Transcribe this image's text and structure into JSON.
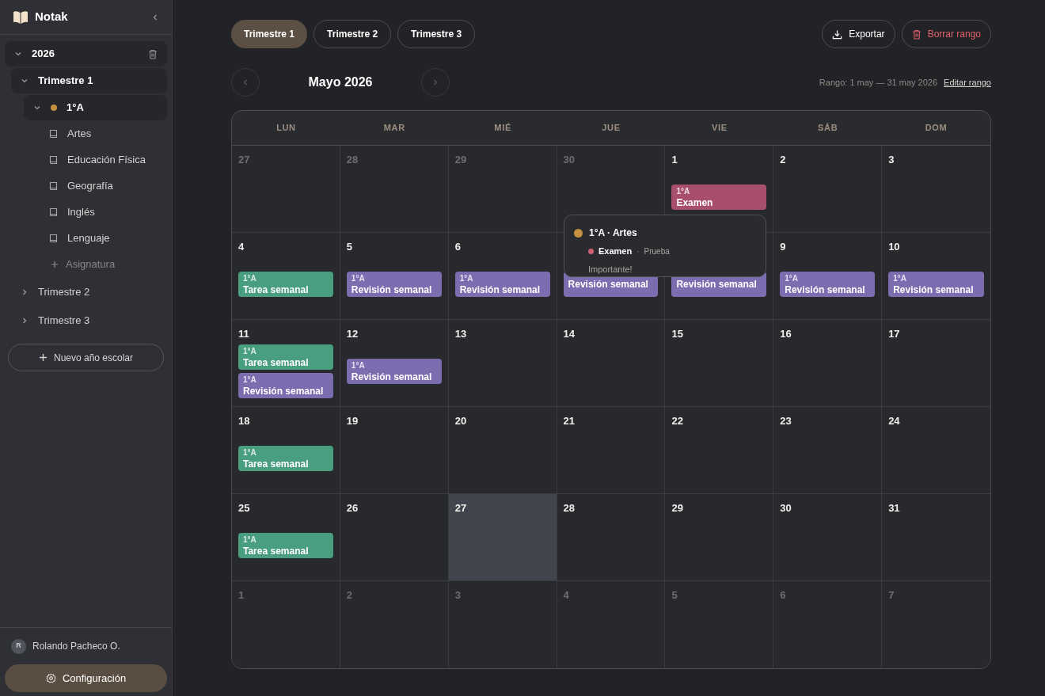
{
  "sidebar": {
    "brand": "Notak",
    "tree": [
      {
        "label": "2026",
        "kind": "year",
        "expanded": true,
        "children": [
          {
            "label": "Trimestre 1",
            "kind": "term",
            "expanded": true,
            "children": [
              {
                "label": "1°A",
                "kind": "class",
                "color": "#c4913f",
                "expanded": true,
                "children": [
                  {
                    "label": "Artes",
                    "kind": "subject"
                  },
                  {
                    "label": "Educación Física",
                    "kind": "subject"
                  },
                  {
                    "label": "Geografía",
                    "kind": "subject"
                  },
                  {
                    "label": "Inglés",
                    "kind": "subject"
                  },
                  {
                    "label": "Lenguaje",
                    "kind": "subject"
                  },
                  {
                    "label": "Asignatura",
                    "kind": "add"
                  }
                ]
              }
            ]
          },
          {
            "label": "Trimestre 2",
            "kind": "term",
            "expanded": false
          },
          {
            "label": "Trimestre 3",
            "kind": "term",
            "expanded": false
          }
        ]
      }
    ],
    "new_year_button": "Nuevo año escolar",
    "user": {
      "initial": "R",
      "name": "Rolando Pacheco O."
    },
    "settings_button": "Configuración"
  },
  "tabs": [
    {
      "label": "Trimestre 1",
      "selected": true
    },
    {
      "label": "Trimestre 2",
      "selected": false
    },
    {
      "label": "Trimestre 3",
      "selected": false
    }
  ],
  "actions": {
    "export": "Exportar",
    "clear": "Borrar rango"
  },
  "month": "Mayo 2026",
  "range": "Rango: 1 may — 31 may 2026",
  "edit_range": "Editar rango",
  "weekdays": [
    "LUN",
    "MAR",
    "MIÉ",
    "JUE",
    "VIE",
    "SÁB",
    "DOM"
  ],
  "weeks": [
    [
      {
        "day": "27",
        "outside": true,
        "today": false
      },
      {
        "day": "28",
        "outside": true,
        "today": false
      },
      {
        "day": "29",
        "outside": true,
        "today": false
      },
      {
        "day": "30",
        "outside": true,
        "today": false
      },
      {
        "day": "1",
        "outside": false,
        "today": false,
        "events": [
          {
            "group": "1°A",
            "title": "Examen",
            "color": "#a84f6c"
          }
        ]
      },
      {
        "day": "2",
        "outside": false,
        "today": false
      },
      {
        "day": "3",
        "outside": false,
        "today": false
      }
    ],
    [
      {
        "day": "4",
        "outside": false,
        "today": false,
        "events": [
          {
            "group": "1°A",
            "title": "Tarea semanal",
            "color": "#4a9e80"
          }
        ]
      },
      {
        "day": "5",
        "outside": false,
        "today": false,
        "events": [
          {
            "group": "1°A",
            "title": "Revisión semanal",
            "color": "#7c6cb0"
          }
        ]
      },
      {
        "day": "6",
        "outside": false,
        "today": false,
        "events": [
          {
            "group": "1°A",
            "title": "Revisión semanal",
            "color": "#7c6cb0"
          }
        ]
      },
      {
        "today": false,
        "events": [
          {
            "title": "Revisión semanal",
            "color": "#7c6cb0"
          }
        ]
      },
      {
        "today": false,
        "events": [
          {
            "title": "Revisión semanal",
            "color": "#7c6cb0"
          }
        ]
      },
      {
        "day": "9",
        "outside": false,
        "today": false,
        "events": [
          {
            "group": "1°A",
            "title": "Revisión semanal",
            "color": "#7c6cb0"
          }
        ]
      },
      {
        "day": "10",
        "outside": false,
        "today": false,
        "events": [
          {
            "group": "1°A",
            "title": "Revisión semanal",
            "color": "#7c6cb0"
          }
        ]
      }
    ],
    [
      {
        "day": "11",
        "outside": false,
        "today": false,
        "events": [
          {
            "group": "1°A",
            "title": "Tarea semanal",
            "color": "#4a9e80"
          },
          {
            "group": "1°A",
            "title": "Revisión semanal",
            "color": "#7c6cb0"
          }
        ]
      },
      {
        "day": "12",
        "outside": false,
        "today": false,
        "events": [
          {
            "group": "1°A",
            "title": "Revisión semanal",
            "color": "#7c6cb0"
          }
        ]
      },
      {
        "day": "13",
        "outside": false,
        "today": false
      },
      {
        "day": "14",
        "outside": false,
        "today": false
      },
      {
        "day": "15",
        "outside": false,
        "today": false
      },
      {
        "day": "16",
        "outside": false,
        "today": false
      },
      {
        "day": "17",
        "outside": false,
        "today": false
      }
    ],
    [
      {
        "day": "18",
        "outside": false,
        "today": false,
        "events": [
          {
            "group": "1°A",
            "title": "Tarea semanal",
            "color": "#4a9e80"
          }
        ]
      },
      {
        "day": "19",
        "outside": false,
        "today": false
      },
      {
        "day": "20",
        "outside": false,
        "today": false
      },
      {
        "day": "21",
        "outside": false,
        "today": false
      },
      {
        "day": "22",
        "outside": false,
        "today": false
      },
      {
        "day": "23",
        "outside": false,
        "today": false
      },
      {
        "day": "24",
        "outside": false,
        "today": false
      }
    ],
    [
      {
        "day": "25",
        "outside": false,
        "today": false,
        "events": [
          {
            "group": "1°A",
            "title": "Tarea semanal",
            "color": "#4a9e80"
          }
        ]
      },
      {
        "day": "26",
        "outside": false,
        "today": false
      },
      {
        "day": "27",
        "outside": false,
        "today": true
      },
      {
        "day": "28",
        "outside": false,
        "today": false
      },
      {
        "day": "29",
        "outside": false,
        "today": false
      },
      {
        "day": "30",
        "outside": false,
        "today": false
      },
      {
        "day": "31",
        "outside": false,
        "today": false
      }
    ],
    [
      {
        "day": "1",
        "outside": true,
        "today": false
      },
      {
        "day": "2",
        "outside": true,
        "today": false
      },
      {
        "day": "3",
        "outside": true,
        "today": false
      },
      {
        "day": "4",
        "outside": true,
        "today": false
      },
      {
        "day": "5",
        "outside": true,
        "today": false
      },
      {
        "day": "6",
        "outside": true,
        "today": false
      },
      {
        "day": "7",
        "outside": true,
        "today": false
      }
    ]
  ],
  "tooltip": {
    "color": "#c4913f",
    "title": "1°A · Artes",
    "tag": {
      "label": "Examen",
      "color": "#d05f72"
    },
    "separator": "·",
    "type": "Prueba",
    "note": "Importante!"
  }
}
